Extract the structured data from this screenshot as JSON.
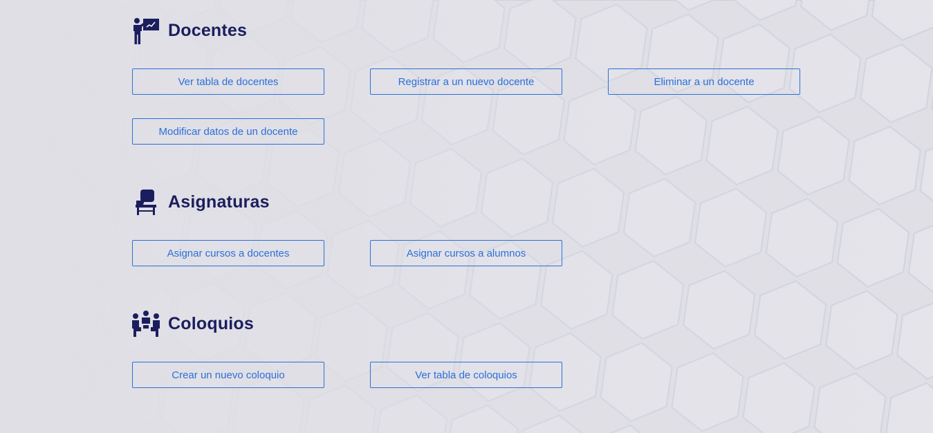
{
  "colors": {
    "background": "#dfdfe5",
    "heading": "#1b1e5e",
    "button_text": "#2d6fd9",
    "button_border": "#2d6fd9"
  },
  "sections": {
    "docentes": {
      "title": "Docentes",
      "icon": "teacher-board-icon",
      "buttons": [
        "Ver tabla de docentes",
        "Registrar a un nuevo docente",
        "Eliminar a un docente",
        "Modificar datos de un docente"
      ]
    },
    "asignaturas": {
      "title": "Asignaturas",
      "icon": "student-desk-icon",
      "buttons": [
        "Asignar cursos a docentes",
        "Asignar cursos a alumnos"
      ]
    },
    "coloquios": {
      "title": "Coloquios",
      "icon": "group-meeting-icon",
      "buttons": [
        "Crear un nuevo coloquio",
        "Ver tabla de coloquios"
      ]
    }
  }
}
